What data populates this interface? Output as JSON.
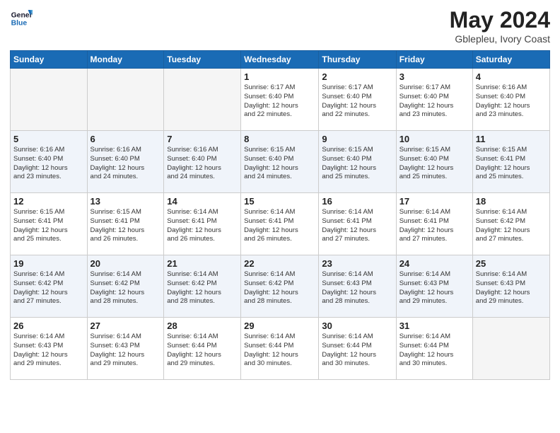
{
  "header": {
    "logo_line1": "General",
    "logo_line2": "Blue",
    "title": "May 2024",
    "subtitle": "Gblepleu, Ivory Coast"
  },
  "weekdays": [
    "Sunday",
    "Monday",
    "Tuesday",
    "Wednesday",
    "Thursday",
    "Friday",
    "Saturday"
  ],
  "rows": [
    [
      {
        "day": "",
        "info": "",
        "empty": true
      },
      {
        "day": "",
        "info": "",
        "empty": true
      },
      {
        "day": "",
        "info": "",
        "empty": true
      },
      {
        "day": "1",
        "info": "Sunrise: 6:17 AM\nSunset: 6:40 PM\nDaylight: 12 hours\nand 22 minutes."
      },
      {
        "day": "2",
        "info": "Sunrise: 6:17 AM\nSunset: 6:40 PM\nDaylight: 12 hours\nand 22 minutes."
      },
      {
        "day": "3",
        "info": "Sunrise: 6:17 AM\nSunset: 6:40 PM\nDaylight: 12 hours\nand 23 minutes."
      },
      {
        "day": "4",
        "info": "Sunrise: 6:16 AM\nSunset: 6:40 PM\nDaylight: 12 hours\nand 23 minutes."
      }
    ],
    [
      {
        "day": "5",
        "info": "Sunrise: 6:16 AM\nSunset: 6:40 PM\nDaylight: 12 hours\nand 23 minutes."
      },
      {
        "day": "6",
        "info": "Sunrise: 6:16 AM\nSunset: 6:40 PM\nDaylight: 12 hours\nand 24 minutes."
      },
      {
        "day": "7",
        "info": "Sunrise: 6:16 AM\nSunset: 6:40 PM\nDaylight: 12 hours\nand 24 minutes."
      },
      {
        "day": "8",
        "info": "Sunrise: 6:15 AM\nSunset: 6:40 PM\nDaylight: 12 hours\nand 24 minutes."
      },
      {
        "day": "9",
        "info": "Sunrise: 6:15 AM\nSunset: 6:40 PM\nDaylight: 12 hours\nand 25 minutes."
      },
      {
        "day": "10",
        "info": "Sunrise: 6:15 AM\nSunset: 6:40 PM\nDaylight: 12 hours\nand 25 minutes."
      },
      {
        "day": "11",
        "info": "Sunrise: 6:15 AM\nSunset: 6:41 PM\nDaylight: 12 hours\nand 25 minutes."
      }
    ],
    [
      {
        "day": "12",
        "info": "Sunrise: 6:15 AM\nSunset: 6:41 PM\nDaylight: 12 hours\nand 25 minutes."
      },
      {
        "day": "13",
        "info": "Sunrise: 6:15 AM\nSunset: 6:41 PM\nDaylight: 12 hours\nand 26 minutes."
      },
      {
        "day": "14",
        "info": "Sunrise: 6:14 AM\nSunset: 6:41 PM\nDaylight: 12 hours\nand 26 minutes."
      },
      {
        "day": "15",
        "info": "Sunrise: 6:14 AM\nSunset: 6:41 PM\nDaylight: 12 hours\nand 26 minutes."
      },
      {
        "day": "16",
        "info": "Sunrise: 6:14 AM\nSunset: 6:41 PM\nDaylight: 12 hours\nand 27 minutes."
      },
      {
        "day": "17",
        "info": "Sunrise: 6:14 AM\nSunset: 6:41 PM\nDaylight: 12 hours\nand 27 minutes."
      },
      {
        "day": "18",
        "info": "Sunrise: 6:14 AM\nSunset: 6:42 PM\nDaylight: 12 hours\nand 27 minutes."
      }
    ],
    [
      {
        "day": "19",
        "info": "Sunrise: 6:14 AM\nSunset: 6:42 PM\nDaylight: 12 hours\nand 27 minutes."
      },
      {
        "day": "20",
        "info": "Sunrise: 6:14 AM\nSunset: 6:42 PM\nDaylight: 12 hours\nand 28 minutes."
      },
      {
        "day": "21",
        "info": "Sunrise: 6:14 AM\nSunset: 6:42 PM\nDaylight: 12 hours\nand 28 minutes."
      },
      {
        "day": "22",
        "info": "Sunrise: 6:14 AM\nSunset: 6:42 PM\nDaylight: 12 hours\nand 28 minutes."
      },
      {
        "day": "23",
        "info": "Sunrise: 6:14 AM\nSunset: 6:43 PM\nDaylight: 12 hours\nand 28 minutes."
      },
      {
        "day": "24",
        "info": "Sunrise: 6:14 AM\nSunset: 6:43 PM\nDaylight: 12 hours\nand 29 minutes."
      },
      {
        "day": "25",
        "info": "Sunrise: 6:14 AM\nSunset: 6:43 PM\nDaylight: 12 hours\nand 29 minutes."
      }
    ],
    [
      {
        "day": "26",
        "info": "Sunrise: 6:14 AM\nSunset: 6:43 PM\nDaylight: 12 hours\nand 29 minutes."
      },
      {
        "day": "27",
        "info": "Sunrise: 6:14 AM\nSunset: 6:43 PM\nDaylight: 12 hours\nand 29 minutes."
      },
      {
        "day": "28",
        "info": "Sunrise: 6:14 AM\nSunset: 6:44 PM\nDaylight: 12 hours\nand 29 minutes."
      },
      {
        "day": "29",
        "info": "Sunrise: 6:14 AM\nSunset: 6:44 PM\nDaylight: 12 hours\nand 30 minutes."
      },
      {
        "day": "30",
        "info": "Sunrise: 6:14 AM\nSunset: 6:44 PM\nDaylight: 12 hours\nand 30 minutes."
      },
      {
        "day": "31",
        "info": "Sunrise: 6:14 AM\nSunset: 6:44 PM\nDaylight: 12 hours\nand 30 minutes."
      },
      {
        "day": "",
        "info": "",
        "empty": true
      }
    ]
  ]
}
